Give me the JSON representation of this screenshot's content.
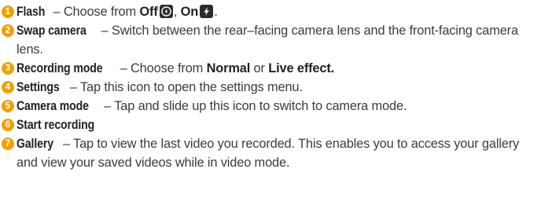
{
  "items": [
    {
      "num": "1",
      "term": "Flash",
      "sep": " – Choose from ",
      "opt1": "Off",
      "mid": ", ",
      "opt2": "On",
      "end": ".",
      "icons": [
        "flash-auto-icon",
        "flash-on-icon"
      ]
    },
    {
      "num": "2",
      "term": "Swap camera",
      "desc": " – Switch between the rear–facing camera lens and the front-facing camera lens."
    },
    {
      "num": "3",
      "term": "Recording mode",
      "sep": " – Choose from ",
      "opt1": "Normal",
      "mid": " or ",
      "opt2": "Live effect."
    },
    {
      "num": "4",
      "term": "Settings",
      "desc": " – Tap this icon to open the settings menu."
    },
    {
      "num": "5",
      "term": "Camera mode",
      "desc": " – Tap and slide up this icon to switch to camera mode."
    },
    {
      "num": "6",
      "term": "Start recording"
    },
    {
      "num": "7",
      "term": "Gallery",
      "desc": " – Tap to view the last video you recorded. This enables you to access your gallery and view your saved videos while in video mode."
    }
  ],
  "colors": {
    "bullet": "#f0a000",
    "text": "#3c3c3c",
    "icon_bg": "#2b2b2b"
  }
}
